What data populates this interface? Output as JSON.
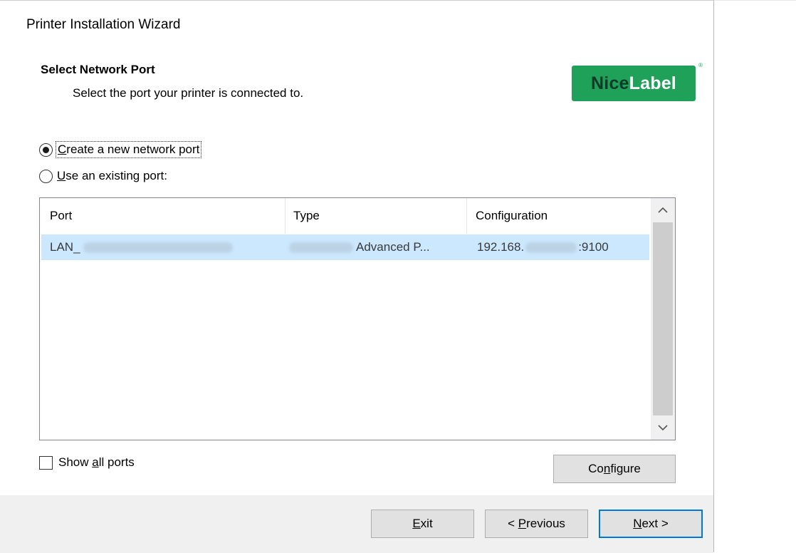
{
  "window": {
    "title": "Printer Installation Wizard"
  },
  "header": {
    "title": "Select Network Port",
    "subtitle": "Select the port your printer is connected to.",
    "logo": {
      "part1": "Nice",
      "part2": "Label",
      "reg_mark": "®",
      "colors": {
        "background": "#1fa15a",
        "dark": "#0b3b27",
        "light": "#ffffff"
      }
    }
  },
  "options": {
    "create_new": {
      "label": "Create a new network port",
      "underline": "C",
      "rest": "reate a new network port",
      "selected": true
    },
    "use_existing": {
      "label": "Use an existing port:",
      "underline": "U",
      "rest": "se an existing port:",
      "selected": false
    }
  },
  "port_table": {
    "columns": [
      "Port",
      "Type",
      "Configuration"
    ],
    "rows": [
      {
        "port": "LAN_",
        "type": "Advanced P...",
        "config_prefix": "192.168.",
        "config_suffix": ":9100",
        "selected": true
      }
    ],
    "selection_color": "#cce8ff"
  },
  "show_all_ports": {
    "prefix": "Show ",
    "underline": "a",
    "rest": "ll ports",
    "checked": false
  },
  "buttons": {
    "configure": {
      "prefix": "Co",
      "underline": "n",
      "rest": "figure"
    },
    "exit": {
      "prefix": "",
      "underline": "E",
      "rest": "xit"
    },
    "previous": {
      "prefix": "< ",
      "underline": "P",
      "rest": "revious"
    },
    "next": {
      "prefix": "",
      "underline": "N",
      "rest": "ext >"
    }
  },
  "icons": {
    "scroll_up": "chevron-up-icon",
    "scroll_down": "chevron-down-icon"
  },
  "accent_color": "#0078d7"
}
